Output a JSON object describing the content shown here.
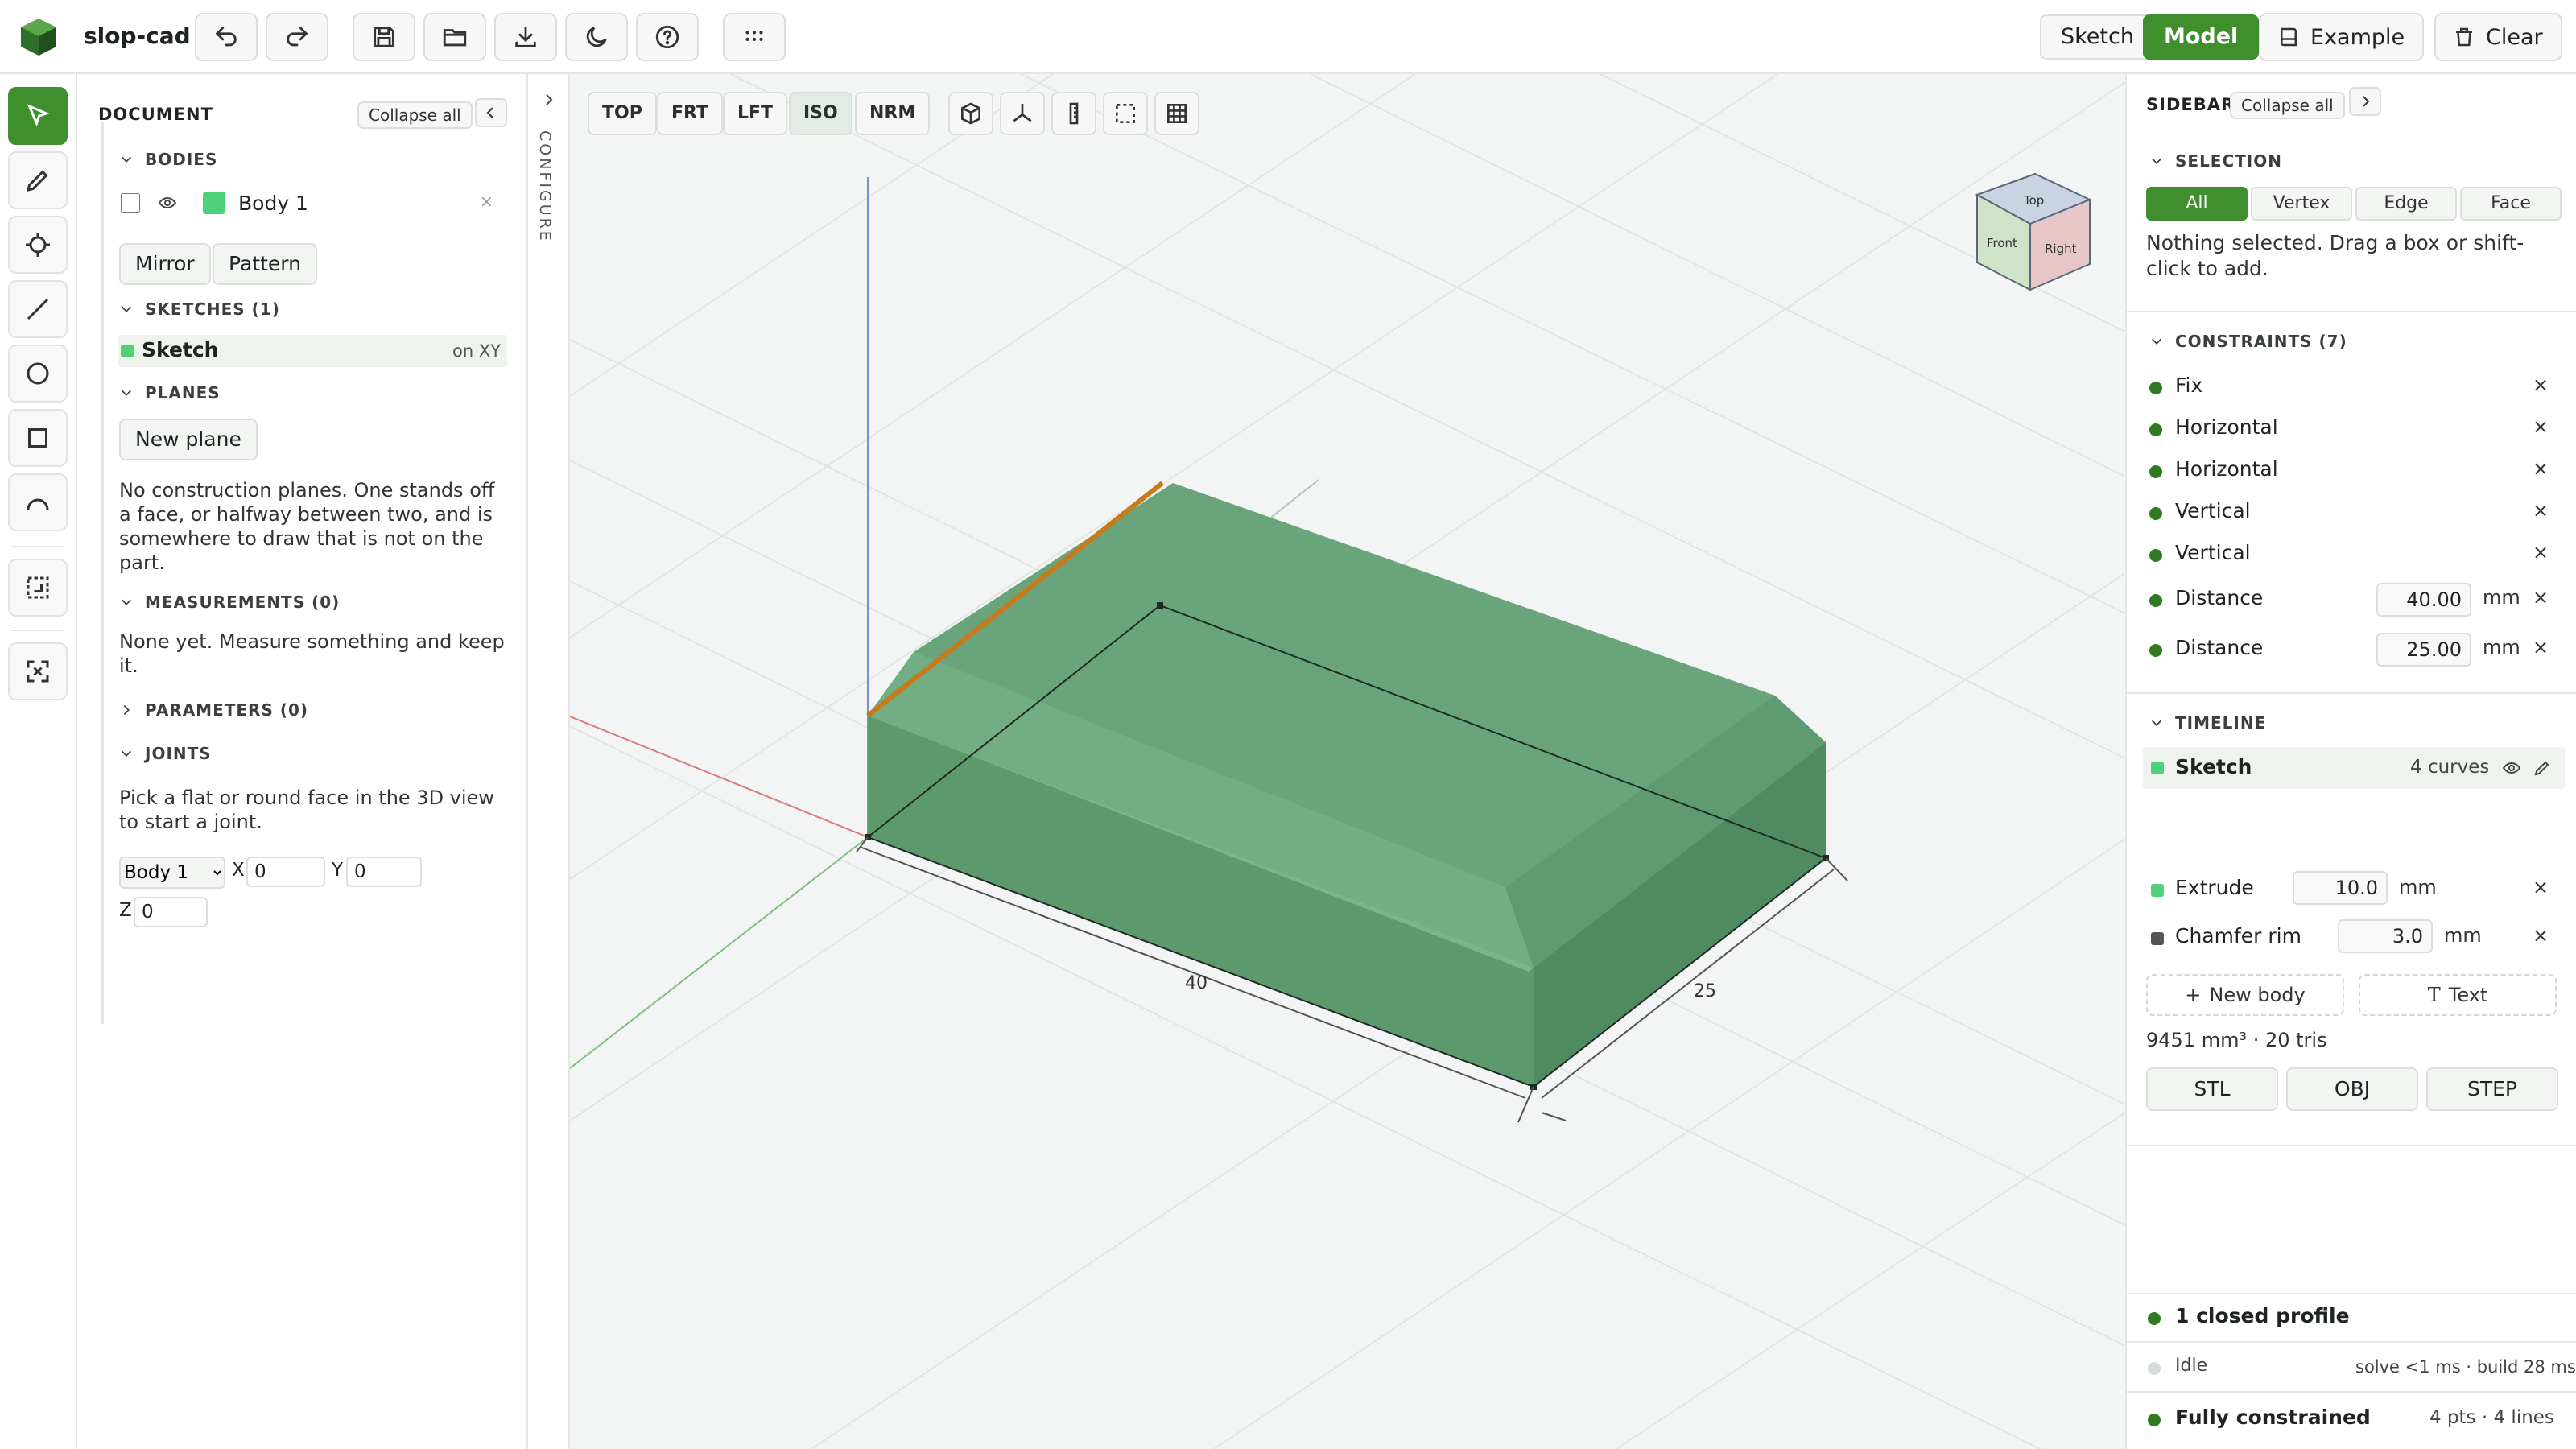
{
  "app": {
    "name": "slop-cad"
  },
  "header": {
    "modes": [
      {
        "label": "Sketch",
        "active": false
      },
      {
        "label": "Model",
        "active": true
      }
    ],
    "example_label": "Example",
    "clear_label": "Clear",
    "icons": [
      "undo-icon",
      "redo-icon",
      "save-icon",
      "open-folder-icon",
      "download-icon",
      "moon-icon",
      "help-icon",
      "grid-dots-icon"
    ]
  },
  "toolrail": {
    "tools": [
      "select-icon",
      "pencil-icon",
      "crosshair-icon",
      "line-icon",
      "circle-icon",
      "rectangle-icon",
      "arc-icon",
      "region-icon",
      "fit-view-icon"
    ]
  },
  "document": {
    "title": "DOCUMENT",
    "collapse_label": "Collapse all",
    "bodies": {
      "header": "BODIES",
      "items": [
        {
          "name": "Body 1",
          "color": "#4fd17a"
        }
      ],
      "close": "×"
    },
    "body_actions": [
      "Mirror",
      "Pattern"
    ],
    "sketches": {
      "header": "SKETCHES (1)",
      "items": [
        {
          "name": "Sketch",
          "plane": "on XY"
        }
      ]
    },
    "planes": {
      "header": "PLANES",
      "button": "New plane",
      "empty": "No construction planes. One stands off a face, or halfway between two, and is somewhere to draw that is not on the part."
    },
    "measurements": {
      "header": "MEASUREMENTS (0)",
      "empty": "None yet. Measure something and keep it."
    },
    "parameters": {
      "header": "PARAMETERS (0)"
    },
    "joints": {
      "header": "JOINTS",
      "hint": "Pick a flat or round face in the 3D view to start a joint.",
      "body_select": "Body 1",
      "x_label": "X",
      "x_value": "0",
      "y_label": "Y",
      "y_value": "0",
      "z_label": "Z",
      "z_value": "0"
    }
  },
  "configure": {
    "label": "CONFIGURE"
  },
  "viewport": {
    "view_buttons": [
      {
        "label": "TOP",
        "active": false
      },
      {
        "label": "FRT",
        "active": false
      },
      {
        "label": "LFT",
        "active": false
      },
      {
        "label": "ISO",
        "active": true
      },
      {
        "label": "NRM",
        "active": false
      }
    ],
    "view_icons": [
      "cube-wire-icon",
      "axes-icon",
      "measure-icon",
      "box-select-icon",
      "grid-icon"
    ],
    "dimensions": {
      "length": "40",
      "width": "25"
    },
    "view_cube": {
      "top": "Top",
      "front": "Front",
      "right": "Right"
    },
    "colors": {
      "body": "#6aa47a",
      "body_side": "#5c9a6d",
      "chamfer_edge": "#c8791a"
    }
  },
  "sidebar": {
    "title": "SIDEBAR",
    "collapse_label": "Collapse all",
    "selection": {
      "header": "SELECTION",
      "filters": [
        {
          "label": "All",
          "active": true
        },
        {
          "label": "Vertex",
          "active": false
        },
        {
          "label": "Edge",
          "active": false
        },
        {
          "label": "Face",
          "active": false
        }
      ],
      "hint": "Nothing selected. Drag a box or shift-click to add."
    },
    "constraints": {
      "header": "CONSTRAINTS (7)",
      "items": [
        {
          "label": "Fix"
        },
        {
          "label": "Horizontal"
        },
        {
          "label": "Horizontal"
        },
        {
          "label": "Vertical"
        },
        {
          "label": "Vertical"
        },
        {
          "label": "Distance",
          "value": "40.00",
          "unit": "mm"
        },
        {
          "label": "Distance",
          "value": "25.00",
          "unit": "mm"
        }
      ],
      "remove": "×"
    },
    "timeline": {
      "header": "TIMELINE",
      "items": [
        {
          "label": "Sketch",
          "info": "4 curves",
          "color": "#4fd17a"
        },
        {
          "label": "Extrude",
          "value": "10.0",
          "unit": "mm",
          "color": "#4fd17a"
        },
        {
          "label": "Chamfer rim",
          "value": "3.0",
          "unit": "mm",
          "color": "#555555"
        }
      ],
      "new_body": "New body",
      "text": "Text",
      "stats": "9451 mm³ · 20 tris",
      "exports": [
        "STL",
        "OBJ",
        "STEP"
      ]
    },
    "status": {
      "profile": "1 closed profile",
      "idle": "Idle",
      "timing": "solve <1 ms · build 28 ms",
      "constraint_state": "Fully constrained",
      "counts": "4 pts · 4 lines"
    }
  }
}
